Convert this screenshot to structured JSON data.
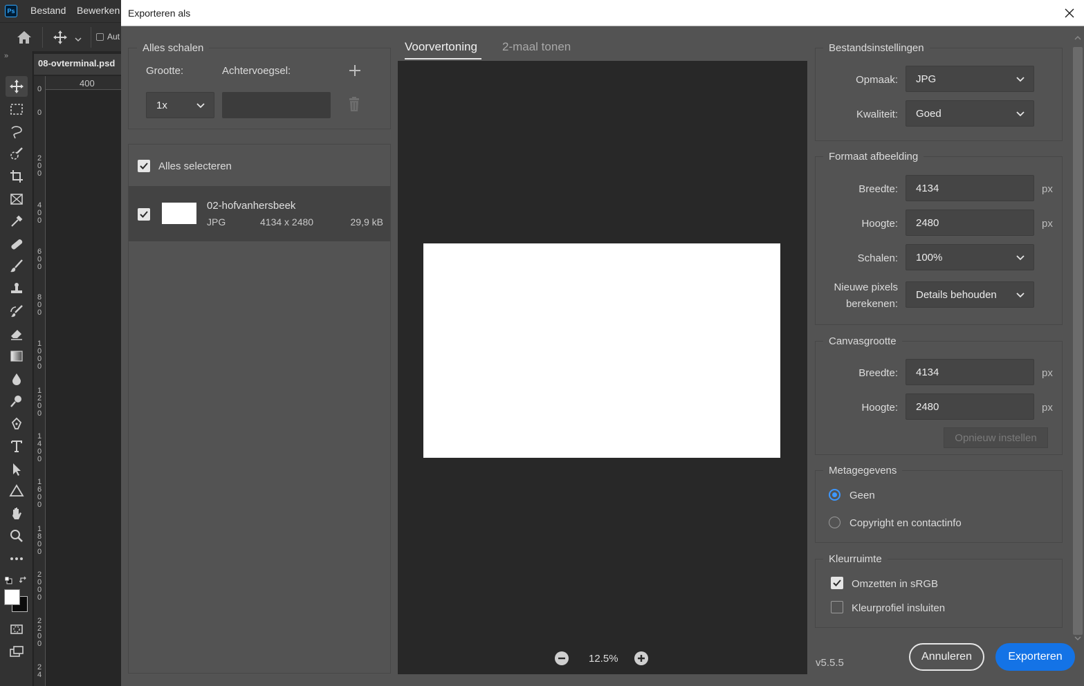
{
  "app": {
    "menu": [
      "Bestand",
      "Bewerken"
    ],
    "options_checkbox_label": "Aut",
    "doc_tab": "08-ovterminal.psd",
    "ruler_top_label": "400",
    "ruler_left_labels": [
      "0",
      "0",
      "200",
      "400",
      "600",
      "800",
      "1000",
      "1200",
      "1400",
      "1600",
      "1800",
      "2000",
      "2200",
      "24"
    ]
  },
  "dialog": {
    "title": "Exporteren als",
    "scale_all": {
      "legend": "Alles schalen",
      "size_label": "Grootte:",
      "suffix_label": "Achtervoegsel:",
      "size_value": "1x",
      "suffix_value": ""
    },
    "select_all_label": "Alles selecteren",
    "file": {
      "name": "02-hofvanhersbeek",
      "format": "JPG",
      "dimensions": "4134 x 2480",
      "size": "29,9 kB"
    },
    "tabs": [
      "Voorvertoning",
      "2-maal tonen"
    ],
    "zoom": "12.5%",
    "file_settings": {
      "legend": "Bestandsinstellingen",
      "format_label": "Opmaak:",
      "format_value": "JPG",
      "quality_label": "Kwaliteit:",
      "quality_value": "Goed"
    },
    "image_size": {
      "legend": "Formaat afbeelding",
      "width_label": "Breedte:",
      "width_value": "4134",
      "height_label": "Hoogte:",
      "height_value": "2480",
      "scale_label": "Schalen:",
      "scale_value": "100%",
      "resample_label_1": "Nieuwe pixels",
      "resample_label_2": "berekenen:",
      "resample_value": "Details behouden",
      "unit": "px"
    },
    "canvas_size": {
      "legend": "Canvasgrootte",
      "width_label": "Breedte:",
      "width_value": "4134",
      "height_label": "Hoogte:",
      "height_value": "2480",
      "reset_label": "Opnieuw instellen",
      "unit": "px"
    },
    "metadata": {
      "legend": "Metagegevens",
      "option_none": "Geen",
      "option_copyright": "Copyright en contactinfo"
    },
    "color_space": {
      "legend": "Kleurruimte",
      "convert_srgb": "Omzetten in sRGB",
      "embed_profile": "Kleurprofiel insluiten"
    },
    "version": "v5.5.5",
    "cancel_label": "Annuleren",
    "export_label": "Exporteren",
    "accent_color": "#1473e6",
    "radio_color": "#3d97ff"
  }
}
